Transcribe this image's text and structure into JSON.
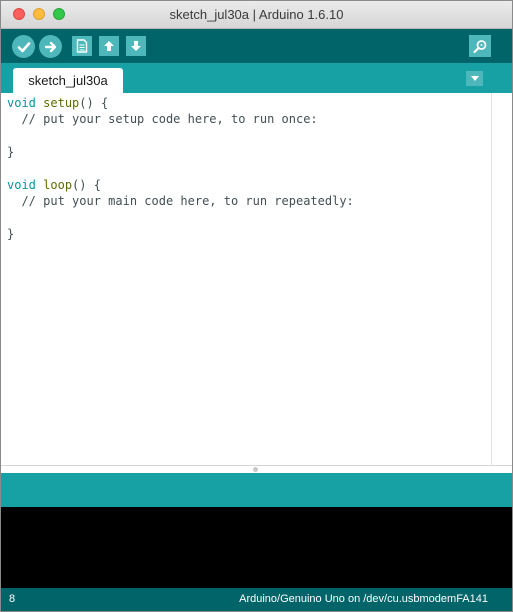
{
  "window": {
    "title": "sketch_jul30a | Arduino 1.6.10"
  },
  "toolbar": {
    "buttons": [
      {
        "name": "verify",
        "icon": "checkmark-icon"
      },
      {
        "name": "upload",
        "icon": "right-arrow-icon"
      },
      {
        "name": "new",
        "icon": "document-icon"
      },
      {
        "name": "open",
        "icon": "up-arrow-icon"
      },
      {
        "name": "save",
        "icon": "down-arrow-icon"
      },
      {
        "name": "serial-monitor",
        "icon": "magnifier-icon"
      }
    ]
  },
  "tabs": [
    {
      "label": "sketch_jul30a",
      "active": true
    }
  ],
  "editor": {
    "lines": [
      {
        "type_kw": "void",
        "func": "setup",
        "rest": "() {"
      },
      {
        "comment": "  // put your setup code here, to run once:"
      },
      {
        "blank": ""
      },
      {
        "text": "}"
      },
      {
        "blank": ""
      },
      {
        "type_kw": "void",
        "func": "loop",
        "rest": "() {"
      },
      {
        "comment": "  // put your main code here, to run repeatedly:"
      },
      {
        "blank": ""
      },
      {
        "text": "}"
      }
    ]
  },
  "status": {
    "line_number": "8",
    "board_port": "Arduino/Genuino Uno on /dev/cu.usbmodemFA141"
  },
  "colors": {
    "toolbar_bg": "#006468",
    "tabbar_bg": "#17a1a5",
    "button_bg": "#4db7bb",
    "keyword_type": "#00979c",
    "keyword_func": "#5e6d03",
    "console_bg": "#000000"
  }
}
